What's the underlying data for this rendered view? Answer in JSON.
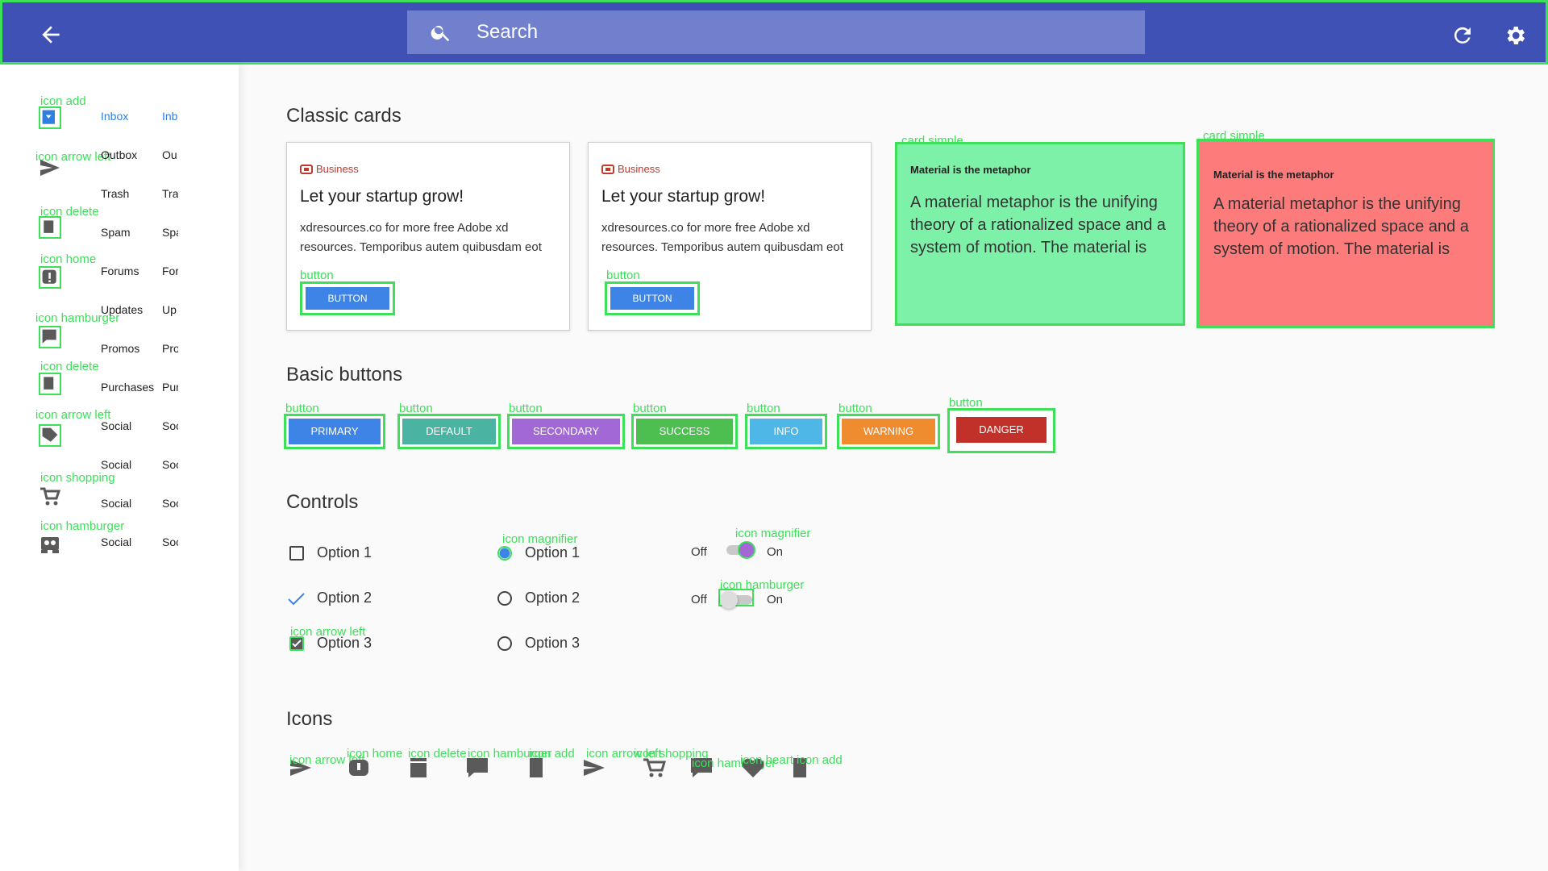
{
  "search": {
    "placeholder": "Search"
  },
  "sidebar": {
    "items": [
      {
        "label": "Inbox",
        "short": "Inb",
        "tag": "icon add"
      },
      {
        "label": "Outbox",
        "short": "Ou",
        "tag": "icon arrow left"
      },
      {
        "label": "Trash",
        "short": "Tra",
        "tag": ""
      },
      {
        "label": "Spam",
        "short": "Spa",
        "tag": "icon delete"
      },
      {
        "label": "Forums",
        "short": "For",
        "tag": "icon home"
      },
      {
        "label": "Updates",
        "short": "Up",
        "tag": ""
      },
      {
        "label": "Promos",
        "short": "Pro",
        "tag": "icon hamburger"
      },
      {
        "label": "Purchases",
        "short": "Pur",
        "tag": "icon delete"
      },
      {
        "label": "Social",
        "short": "Soc",
        "tag": "icon arrow left"
      },
      {
        "label": "Social",
        "short": "Soc",
        "tag": ""
      },
      {
        "label": "Social",
        "short": "Soc",
        "tag": "icon shopping"
      },
      {
        "label": "Social",
        "short": "Soc",
        "tag": "icon hamburger"
      }
    ]
  },
  "sections": {
    "cards": "Classic cards",
    "buttons": "Basic buttons",
    "controls": "Controls",
    "icons": "Icons"
  },
  "cards": [
    {
      "category": "Business",
      "title": "Let your startup grow!",
      "body": "xdresources.co for more free Adobe xd resources. Temporibus autem quibusdam eot",
      "button": "BUTTON",
      "tag": "button"
    },
    {
      "category": "Business",
      "title": "Let your startup grow!",
      "body": "xdresources.co for more free Adobe xd resources. Temporibus autem quibusdam eot",
      "button": "BUTTON",
      "tag": "button"
    }
  ],
  "simple_cards": [
    {
      "tag": "card simple",
      "title": "Material is the metaphor",
      "body": "A material metaphor is the unifying theory of a rationalized space and a system of motion. The material is",
      "color": "#7ef1a8"
    },
    {
      "tag": "card simple",
      "title": "Material is the metaphor",
      "body": "A material metaphor is the unifying theory of a rationalized space and a system of motion. The material is",
      "color": "#fd7b7b"
    }
  ],
  "buttons": [
    {
      "label": "PRIMARY",
      "tag": "button",
      "color": "#3d84e6"
    },
    {
      "label": "DEFAULT",
      "tag": "button",
      "color": "#4ab3a2"
    },
    {
      "label": "SECONDARY",
      "tag": "button",
      "color": "#a269d6"
    },
    {
      "label": "SUCCESS",
      "tag": "button",
      "color": "#4cbf50"
    },
    {
      "label": "INFO",
      "tag": "button",
      "color": "#4fb7e8"
    },
    {
      "label": "WARNING",
      "tag": "button",
      "color": "#ef8c2f"
    },
    {
      "label": "DANGER",
      "tag": "button",
      "color": "#c2302a"
    }
  ],
  "controls": {
    "checkboxes": [
      {
        "label": "Option 1",
        "state": "unchecked"
      },
      {
        "label": "Option 2",
        "state": "checkmark"
      },
      {
        "label": "Option 3",
        "state": "checked",
        "tag": "icon arrow left"
      }
    ],
    "radios": [
      {
        "label": "Option 1",
        "selected": true,
        "tag": "icon magnifier"
      },
      {
        "label": "Option 2",
        "selected": false
      },
      {
        "label": "Option 3",
        "selected": false
      }
    ],
    "toggles": [
      {
        "off": "Off",
        "on": "On",
        "state": "on",
        "tag": "icon magnifier"
      },
      {
        "off": "Off",
        "on": "On",
        "state": "off",
        "tag": "icon hamburger"
      }
    ]
  },
  "icon_row": {
    "icons": [
      "arrow-left-icon",
      "home-icon",
      "delete-icon",
      "hamburger-icon",
      "add-icon",
      "arrow-left-icon",
      "shopping-icon",
      "hamburger-icon",
      "heart-icon",
      "add-icon"
    ],
    "tags": [
      "icon arrow left",
      "icon home",
      "icon delete",
      "icon hamburger",
      "icon add",
      "icon arrow left",
      "icon shopping",
      "icon hamburger",
      "icon heart",
      "icon add"
    ]
  },
  "colors": {
    "topbar": "#3f51b5",
    "accent": "#3d84e6",
    "annotation": "#3ee05a",
    "icon": "#5a5a5a"
  }
}
